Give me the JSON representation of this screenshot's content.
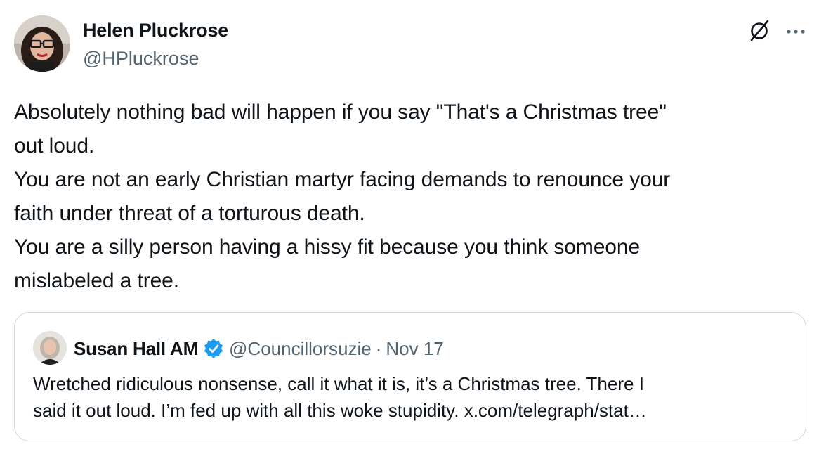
{
  "author": {
    "name": "Helen Pluckrose",
    "handle": "@HPluckrose"
  },
  "tweet": {
    "lines": [
      "Absolutely nothing bad will happen if you say \"That's a Christmas tree\"",
      "out loud.",
      "You are not an early Christian martyr facing demands to renounce your",
      "faith under threat of a torturous death.",
      "You are a silly person having a hissy fit because you think someone",
      "mislabeled a tree."
    ]
  },
  "quote": {
    "name": "Susan Hall AM",
    "verified": true,
    "handle": "@Councillorsuzie",
    "separator": "·",
    "date": "Nov 17",
    "lines": [
      "Wretched ridiculous nonsense, call it what it is, it’s a Christmas tree. There I",
      "said it out loud. I’m fed up with all this woke stupidity. x.com/telegraph/stat…"
    ]
  },
  "colors": {
    "text": "#0f1419",
    "secondary": "#536471",
    "verified": "#1d9bf0",
    "border": "#cfd9de"
  },
  "icons": {
    "grok": "grok-icon",
    "more": "more-icon",
    "verified": "verified-badge-icon"
  }
}
